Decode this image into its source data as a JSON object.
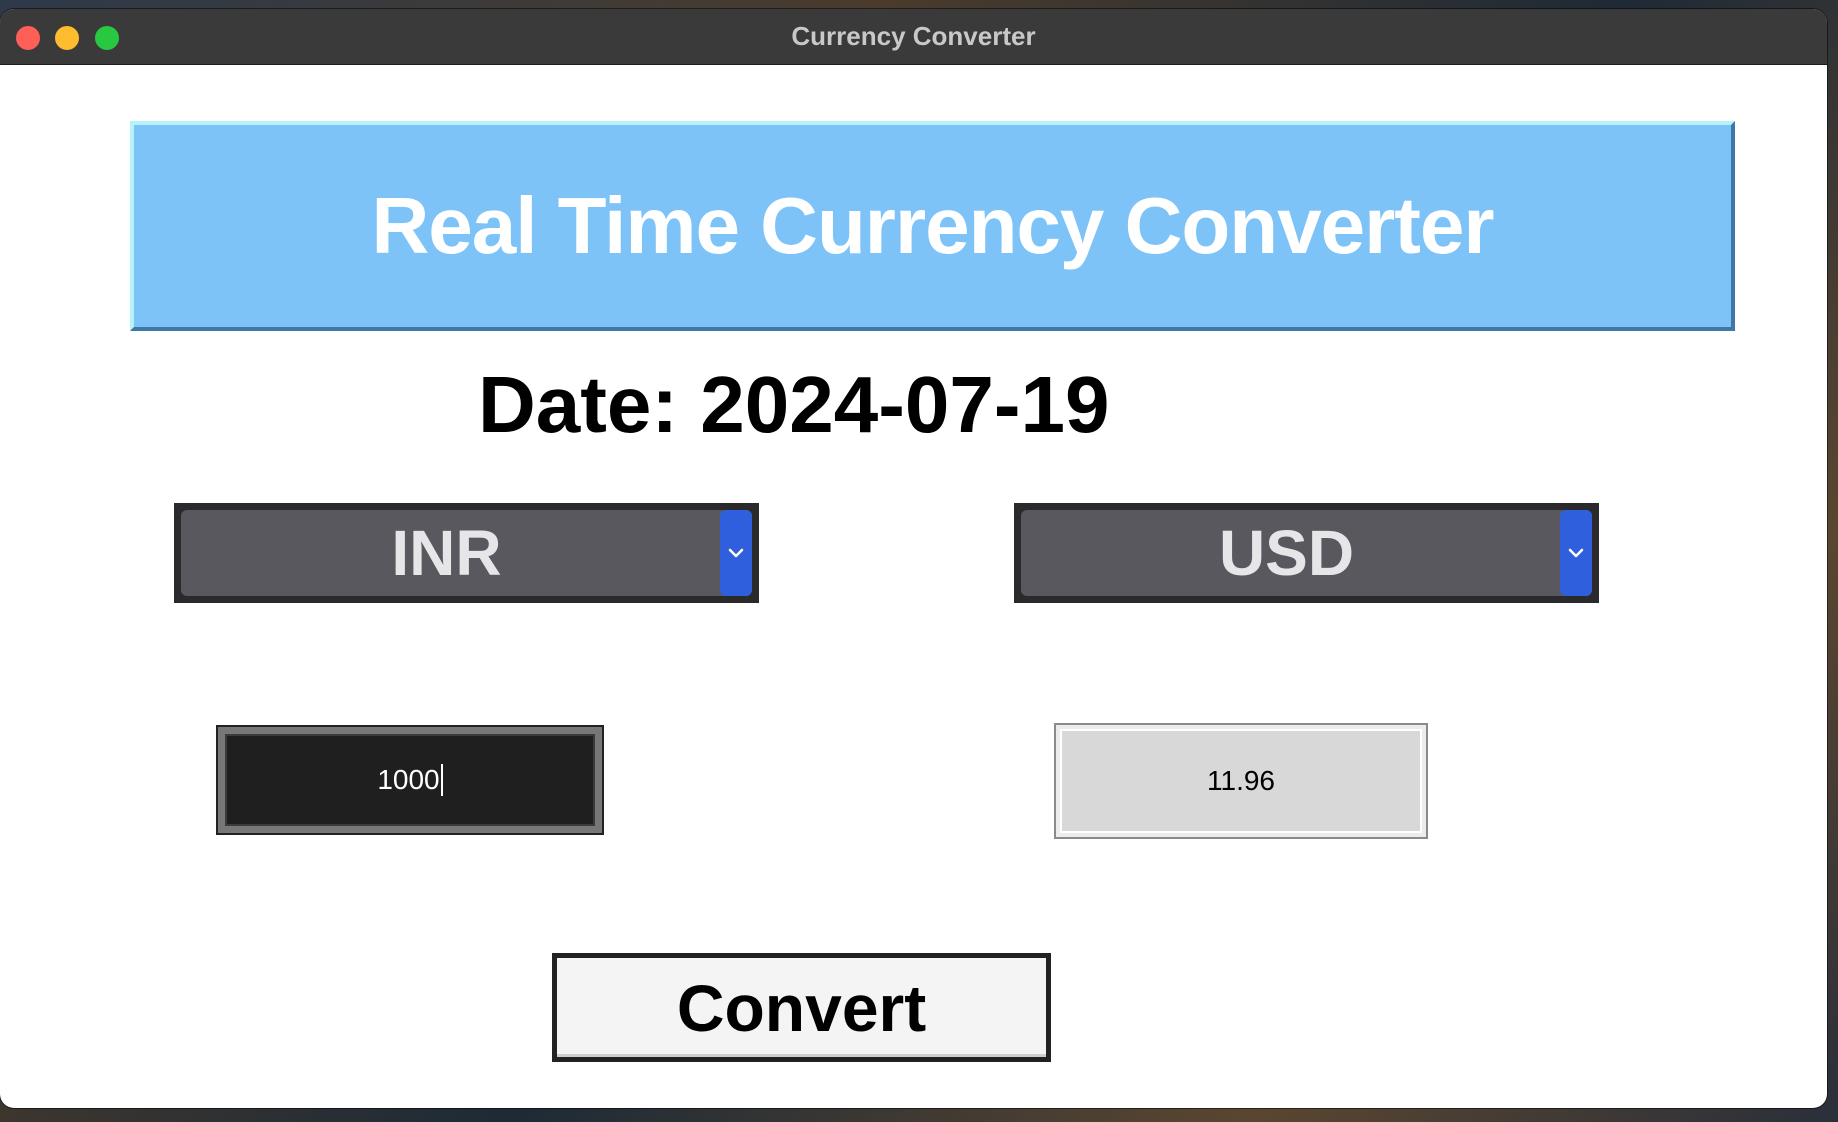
{
  "window": {
    "title": "Currency Converter"
  },
  "header": {
    "title": "Real Time Currency Converter"
  },
  "date_label": "Date: 2024-07-19",
  "from_currency": {
    "selected": "INR",
    "icon": "chevron-down-icon"
  },
  "to_currency": {
    "selected": "USD",
    "icon": "chevron-down-icon"
  },
  "amount_input": {
    "value": "1000"
  },
  "converted_output": {
    "value": "11.96"
  },
  "convert_button": {
    "label": "Convert"
  },
  "colors": {
    "banner": "#7dc3f7",
    "dropdown_arrow": "#2f5fdc",
    "titlebar": "#3a3a3a"
  }
}
